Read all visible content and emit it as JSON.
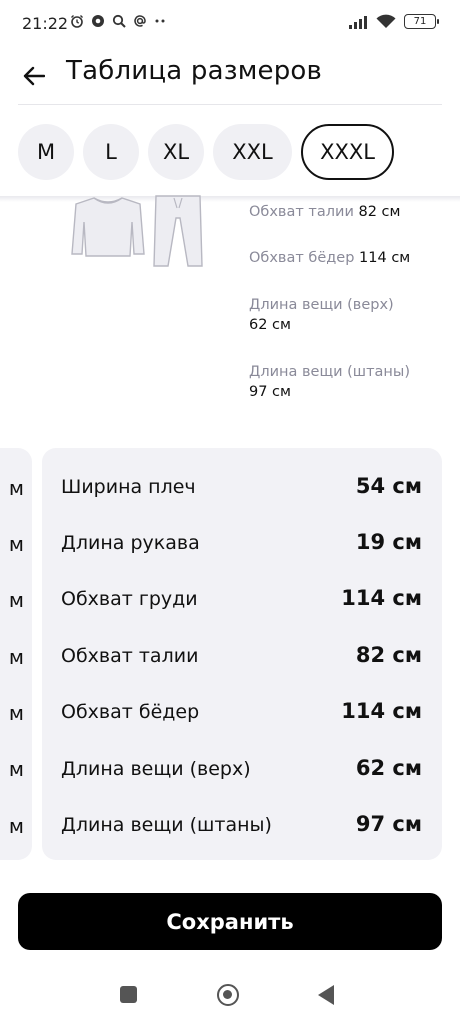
{
  "status_bar": {
    "time": "21:22",
    "battery": "71",
    "left_icons": [
      "alarm-icon",
      "shield-icon",
      "search-icon",
      "at-icon",
      "more-dots-icon"
    ],
    "right_icons": [
      "signal-icon",
      "wifi-icon",
      "battery-icon"
    ]
  },
  "header": {
    "title": "Таблица размеров",
    "back_icon": "arrow-left-icon"
  },
  "sizes": [
    {
      "label": "M",
      "selected": false
    },
    {
      "label": "L",
      "selected": false
    },
    {
      "label": "XL",
      "selected": false
    },
    {
      "label": "XXL",
      "selected": false
    },
    {
      "label": "XXXL",
      "selected": true
    }
  ],
  "illustration": {
    "icons": [
      "sweatshirt-icon",
      "pants-icon"
    ]
  },
  "measure_list": [
    {
      "label": "Обхват талии",
      "value": "82 см"
    },
    {
      "label": "Обхват бёдер",
      "value": "114 см"
    },
    {
      "label": "Длина вещи (верх)",
      "value": "62 см"
    },
    {
      "label": "Длина вещи (штаны)",
      "value": "97 см"
    }
  ],
  "left_card_cutoff": [
    "м",
    "м",
    "м",
    "м",
    "м",
    "м",
    "м"
  ],
  "table": [
    {
      "label": "Ширина плеч",
      "value": "54 см"
    },
    {
      "label": "Длина рукава",
      "value": "19 см"
    },
    {
      "label": "Обхват груди",
      "value": "114 см"
    },
    {
      "label": "Обхват талии",
      "value": "82 см"
    },
    {
      "label": "Обхват бёдер",
      "value": "114 см"
    },
    {
      "label": "Длина вещи (верх)",
      "value": "62 см"
    },
    {
      "label": "Длина вещи (штаны)",
      "value": "97 см"
    }
  ],
  "save_button": {
    "label": "Сохранить"
  },
  "nav_bar": {
    "icons": [
      "recent-apps-icon",
      "home-icon",
      "back-icon"
    ]
  },
  "colors": {
    "accent": "#000000",
    "card_bg": "#f2f2f6",
    "chip_bg": "#f0f0f4",
    "muted_text": "#8a8a99"
  }
}
